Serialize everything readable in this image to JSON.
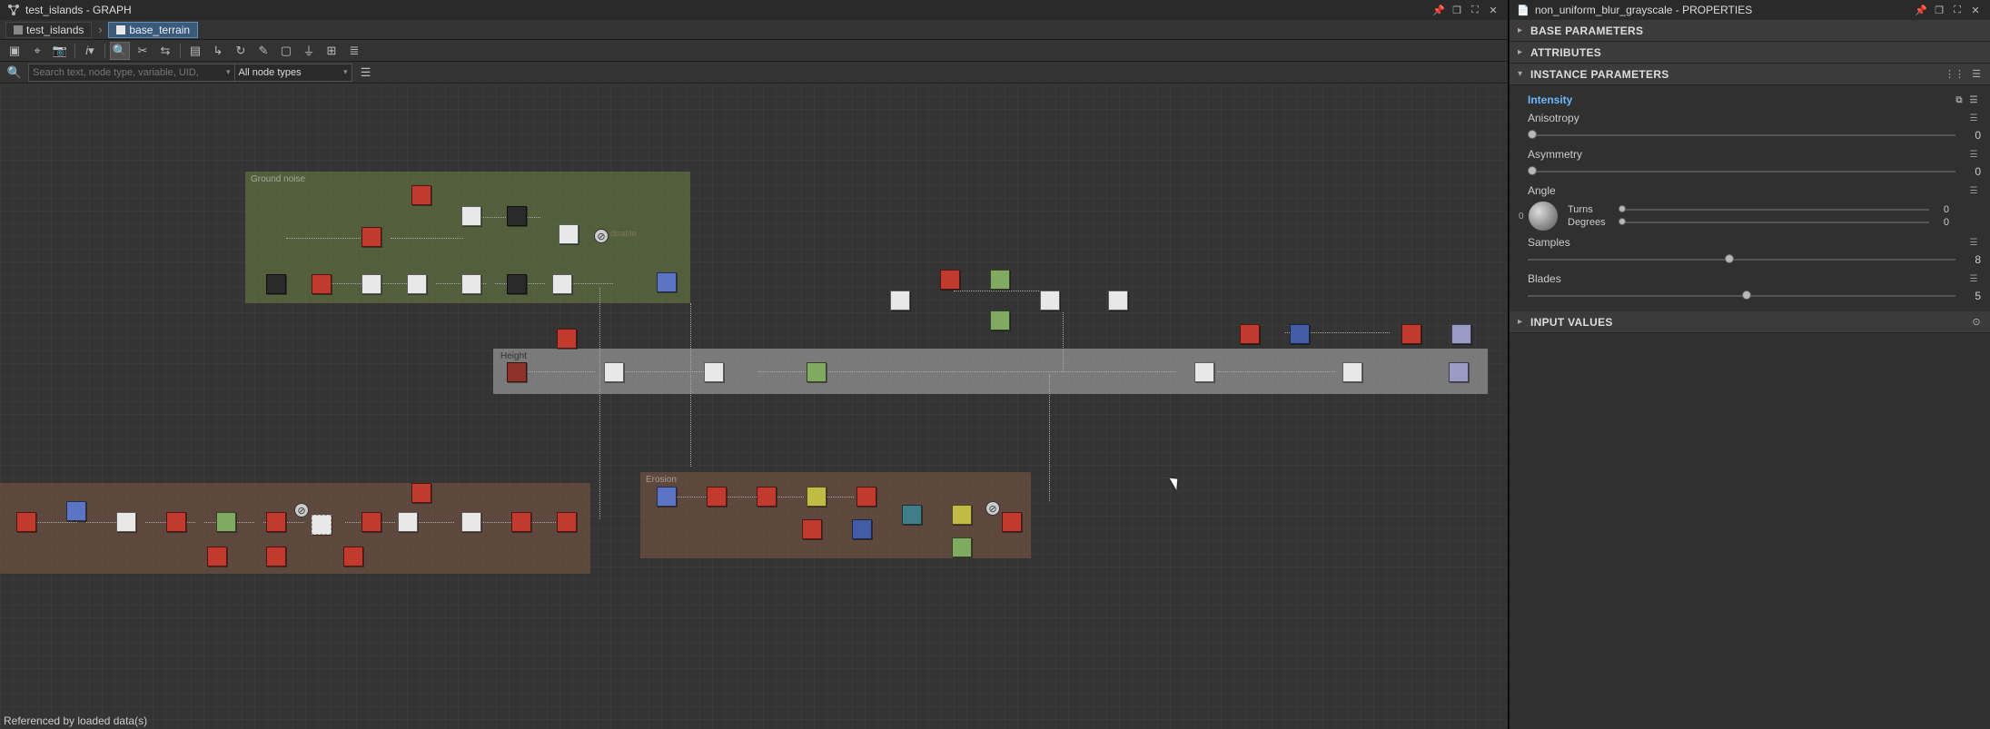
{
  "graph_panel": {
    "title_prefix": "test_islands",
    "title_suffix": "GRAPH",
    "title_combined": "test_islands - GRAPH",
    "breadcrumb": [
      {
        "label": "test_islands"
      },
      {
        "label": "base_terrain"
      }
    ],
    "search": {
      "placeholder": "Search text, node type, variable, UID,",
      "type_filter": "All node types"
    },
    "status": "Referenced by loaded data(s)",
    "frames": {
      "ground_noise_label": "Ground noise",
      "height_label": "Height",
      "erosion_label": "Erosion",
      "disabled_text": "disable"
    }
  },
  "props_panel": {
    "title_name": "non_uniform_blur_grayscale",
    "title_suffix": "PROPERTIES",
    "title_combined": "non_uniform_blur_grayscale - PROPERTIES",
    "sections": {
      "base": "BASE PARAMETERS",
      "attributes": "ATTRIBUTES",
      "instance": "INSTANCE PARAMETERS",
      "input_values": "INPUT VALUES"
    },
    "params": {
      "intensity_label": "Intensity",
      "anisotropy": {
        "label": "Anisotropy",
        "value": "0",
        "pos": 0
      },
      "asymmetry": {
        "label": "Asymmetry",
        "value": "0",
        "pos": 0
      },
      "angle": {
        "label": "Angle",
        "turns_label": "Turns",
        "turns_value": "0",
        "degrees_label": "Degrees",
        "degrees_value": "0",
        "dial_zero": "0"
      },
      "samples": {
        "label": "Samples",
        "value": "8",
        "pos": 46
      },
      "blades": {
        "label": "Blades",
        "value": "5",
        "pos": 50
      }
    }
  }
}
